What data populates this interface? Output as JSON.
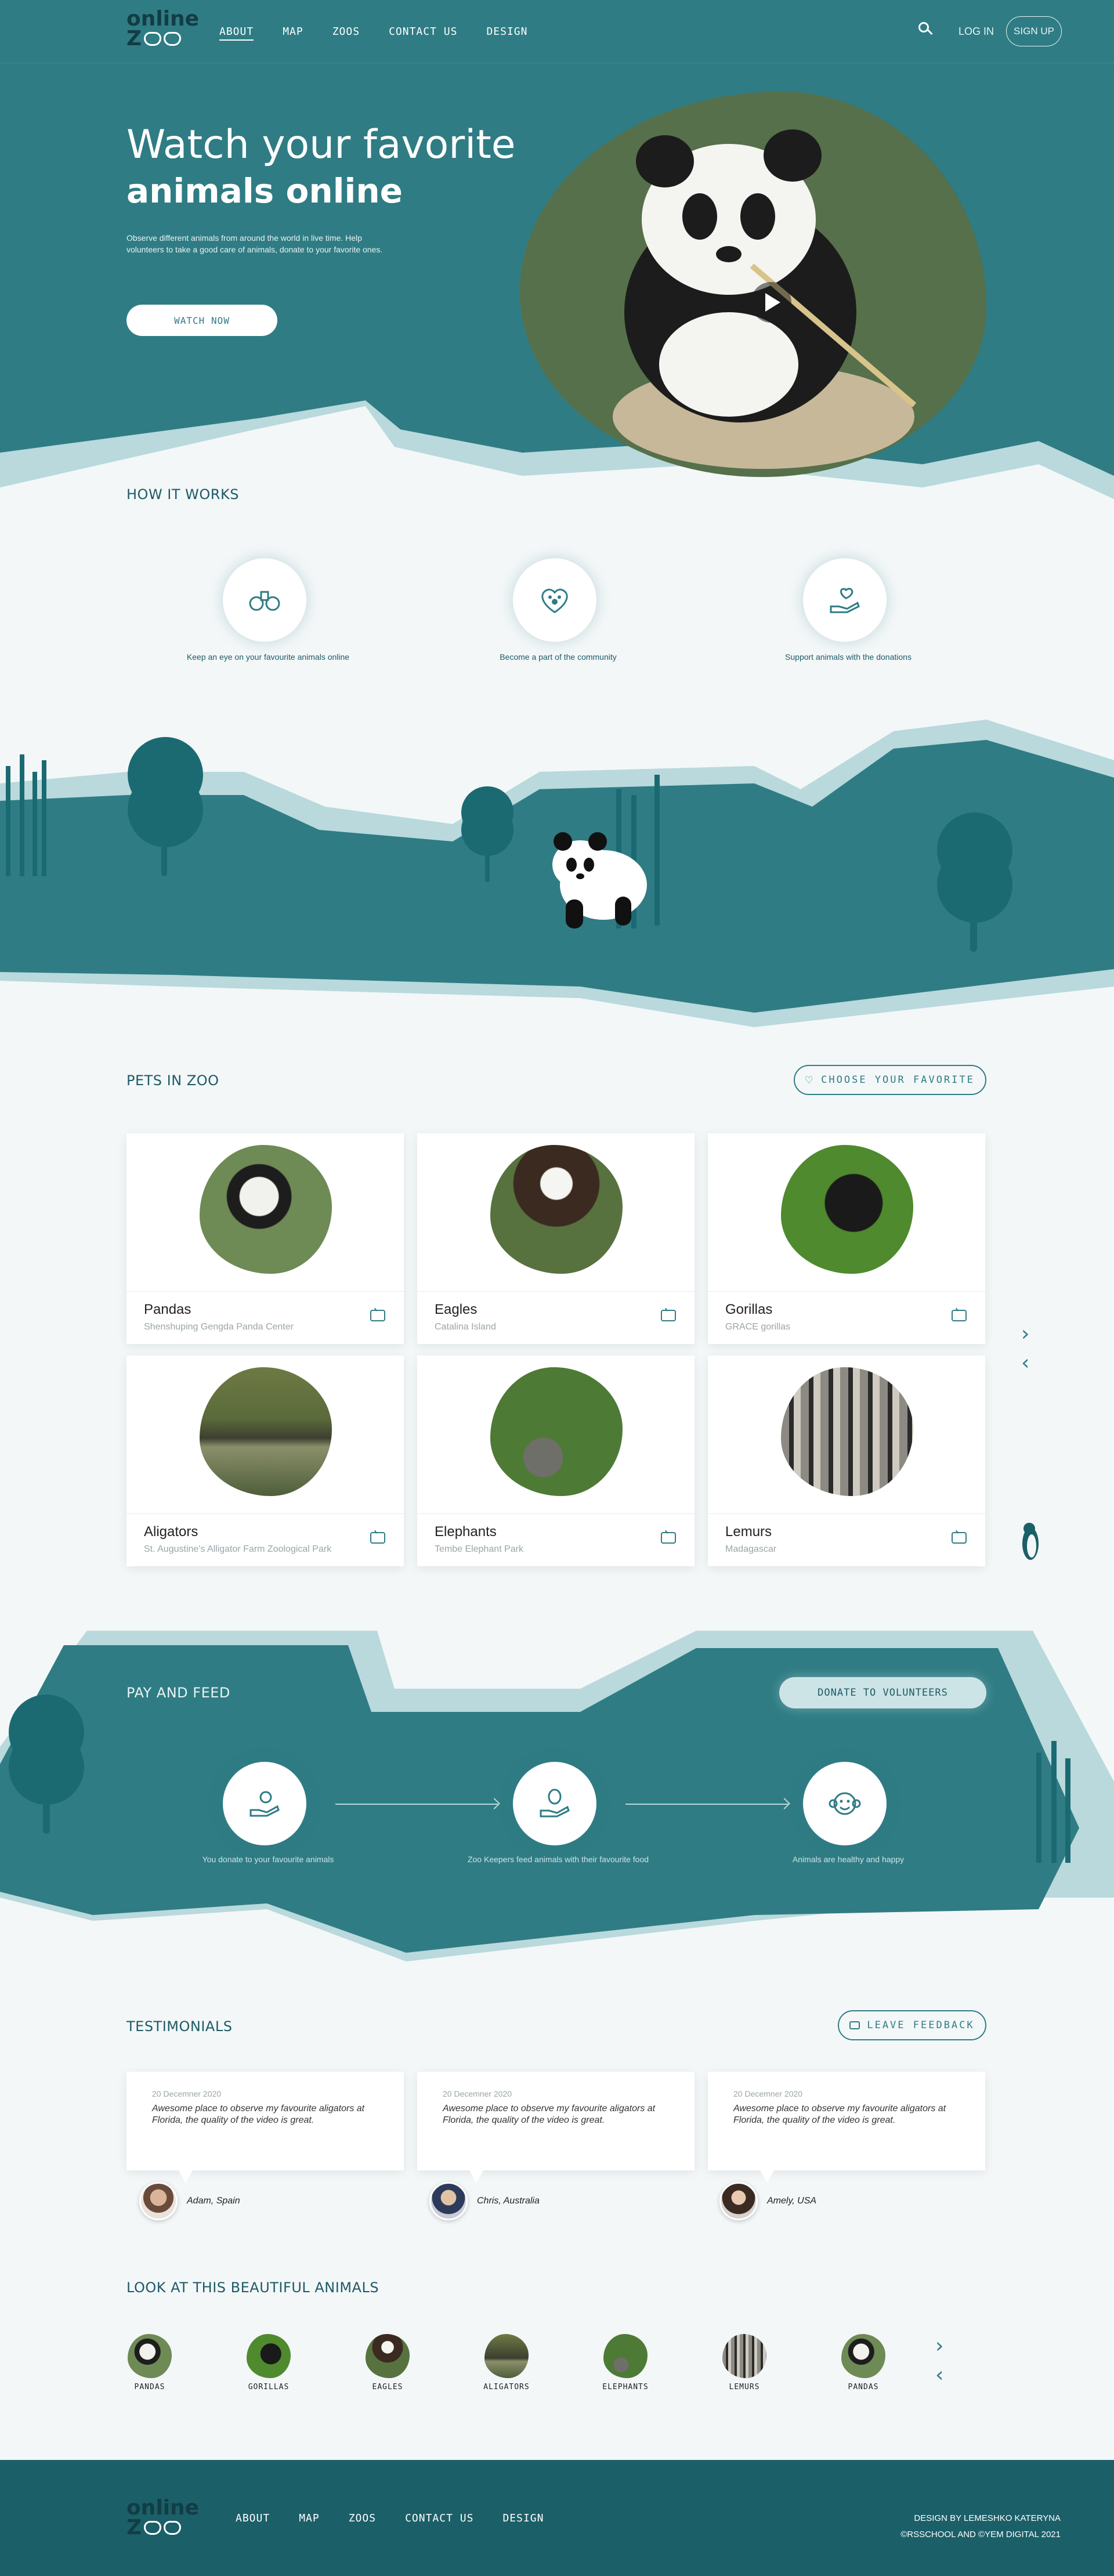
{
  "header": {
    "logo_top": "online",
    "logo_bottom": "Z",
    "nav": [
      "ABOUT",
      "MAP",
      "ZOOS",
      "CONTACT US",
      "DESIGN"
    ],
    "login": "LOG IN",
    "signup": "SIGN UP"
  },
  "hero": {
    "title_line1": "Watch your favorite",
    "title_line2": "animals online",
    "subtitle": "Observe different animals from around the world in live time. Help volunteers to take a good care of animals, donate to your favorite ones.",
    "cta": "WATCH NOW"
  },
  "how": {
    "title": "HOW IT WORKS",
    "steps": [
      {
        "icon": "binoculars-icon",
        "label": "Keep an eye on your favourite animals online"
      },
      {
        "icon": "heart-paw-icon",
        "label": "Become a part of the community"
      },
      {
        "icon": "hand-heart-icon",
        "label": "Support animals with the donations"
      }
    ]
  },
  "pets": {
    "title": "PETS IN ZOO",
    "choose": "CHOOSE YOUR FAVORITE",
    "cards": [
      {
        "name": "Pandas",
        "place": "Shenshuping Gengda Panda Center"
      },
      {
        "name": "Eagles",
        "place": "Catalina Island"
      },
      {
        "name": "Gorillas",
        "place": "GRACE gorillas"
      },
      {
        "name": "Aligators",
        "place": "St. Augustine's Alligator Farm Zoological Park"
      },
      {
        "name": "Elephants",
        "place": "Tembe Elephant Park"
      },
      {
        "name": "Lemurs",
        "place": "Madagascar"
      }
    ]
  },
  "pay": {
    "title": "PAY AND FEED",
    "donate": "DONATE TO VOLUNTEERS",
    "steps": [
      {
        "icon": "donate-icon",
        "label": "You donate to your favourite animals"
      },
      {
        "icon": "feed-icon",
        "label": "Zoo Keepers feed animals with their favourite food"
      },
      {
        "icon": "happy-monkey-icon",
        "label": "Animals are healthy and happy"
      }
    ]
  },
  "testimonials": {
    "title": "TESTIMONIALS",
    "leave": "LEAVE FEEDBACK",
    "items": [
      {
        "date": "20 Decemner 2020",
        "text": "Awesome place to observe my favourite aligators at Florida, the quality of the video is great.",
        "author": "Adam, Spain"
      },
      {
        "date": "20 Decemner 2020",
        "text": "Awesome place to observe my favourite aligators at Florida, the quality of the video is great.",
        "author": "Chris, Australia"
      },
      {
        "date": "20 Decemner 2020",
        "text": "Awesome place to observe my favourite aligators at Florida, the quality of the video is great.",
        "author": "Amely, USA"
      }
    ]
  },
  "beautiful": {
    "title": "LOOK AT THIS BEAUTIFUL ANIMALS",
    "items": [
      "PANDAS",
      "GORILLAS",
      "EAGLES",
      "ALIGATORS",
      "ELEPHANTS",
      "LEMURS",
      "PANDAS"
    ]
  },
  "footer": {
    "logo_top": "online",
    "logo_bottom": "Z",
    "nav": [
      "ABOUT",
      "MAP",
      "ZOOS",
      "CONTACT US",
      "DESIGN"
    ],
    "credit1": "DESIGN BY LEMESHKO KATERYNA",
    "credit2": "©RSSCHOOL AND ©YEM DIGITAL 2021"
  },
  "colors": {
    "teal": "#2f7c84",
    "dark_teal": "#1b5f68",
    "light_teal": "#b9d9dc",
    "background": "#f3f7f8"
  }
}
